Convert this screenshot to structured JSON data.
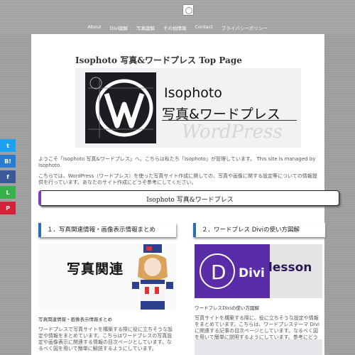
{
  "nav": {
    "items": [
      "About",
      "Divi図解",
      "写真図解",
      "その他情報",
      "Contact",
      "プライバシーポリシー"
    ]
  },
  "page": {
    "title": "Isophoto 写真&ワードプレス Top Page"
  },
  "banner": {
    "title_line1": "Isophoto",
    "title_line2": "写真&ワードプレス",
    "ghost_text": "WordPress"
  },
  "intro": {
    "p1": "ようこそ「Isophoto 写真&ワードプレス」へ。こちらは私たち「Isophoto」が管理しています。 This site is managed by Isophoto.",
    "p2": "こちらでは、WordPress（ワードプレス）を使った写真サイト作成に関しての、写真や画像に関する設定等についての情報提供を行っています。あなたのサイト作成にどうぞ参考にしてください。"
  },
  "section_box": {
    "label": "Isophoto 写真&ワードプレス"
  },
  "columns": {
    "left": {
      "heading": "１．写真関連情報・画像表示情報まとめ",
      "image_text": "写真関連",
      "subheading": "写真関連情報・画像表示情報まとめ",
      "body": "ワードプレスで写真サイトを構築する際に役に立ちそうな設定や情報をまとめています。こちらはワードプレスの写真設定や画像表示に関連する情報の目次ページとしています。なるべく図を用いて簡単に解説するようにしています。"
    },
    "right": {
      "heading": "２．ワードプレス Diviの使い方図解",
      "image_text_divi": "Divi",
      "image_text_lesson": "lesson",
      "subheading": "ワードプレスDiviの使い方図解",
      "body": "写真サイトを構築する際に、役に立ちそうな設定や情報をまとめています。こちらは、ワードプレステーマ Divi に関連する記事の目次ページとしています。なるべく図を用いて簡単に説明するようにしています。参考にどうぞ。"
    }
  },
  "share": {
    "buttons": [
      {
        "icon": "twitter-icon",
        "glyph": "t",
        "color": "#1da1f2"
      },
      {
        "icon": "hatena-icon",
        "glyph": "B!",
        "color": "#2a7cd3"
      },
      {
        "icon": "facebook-icon",
        "glyph": "f",
        "color": "#3b5998"
      },
      {
        "icon": "line-icon",
        "glyph": "L",
        "color": "#35b34a"
      },
      {
        "icon": "pinterest-icon",
        "glyph": "P",
        "color": "#d3213a"
      }
    ]
  }
}
